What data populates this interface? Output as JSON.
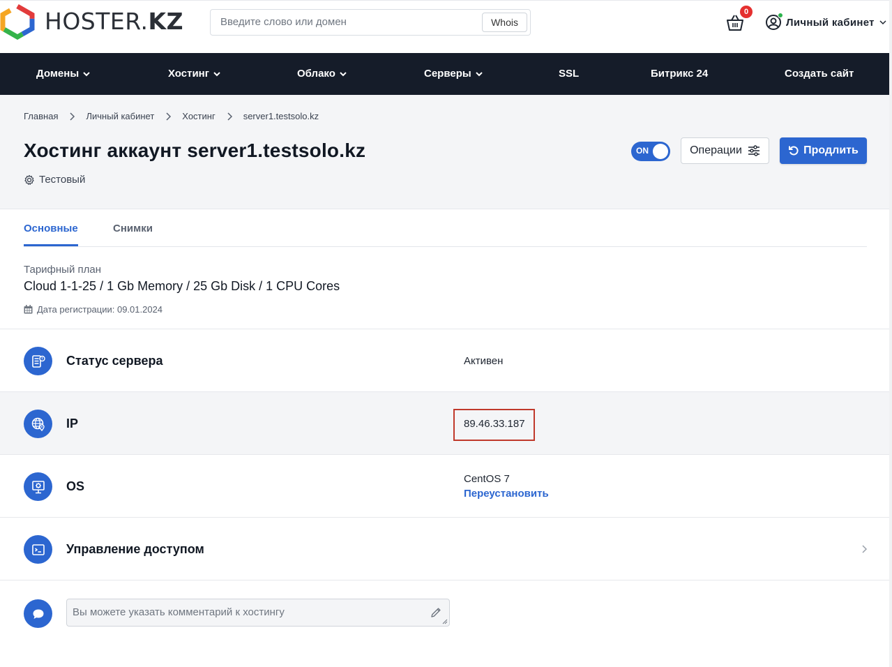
{
  "header": {
    "logo_text_light": "HOSTER.",
    "logo_text_bold": "KZ",
    "search_placeholder": "Введите слово или домен",
    "whois_label": "Whois",
    "cart_count": "0",
    "account_label": "Личный кабинет"
  },
  "nav": {
    "items": [
      {
        "label": "Домены",
        "has_dropdown": true
      },
      {
        "label": "Хостинг",
        "has_dropdown": true
      },
      {
        "label": "Облако",
        "has_dropdown": true
      },
      {
        "label": "Серверы",
        "has_dropdown": true
      },
      {
        "label": "SSL",
        "has_dropdown": false
      },
      {
        "label": "Битрикс 24",
        "has_dropdown": false
      },
      {
        "label": "Создать сайт",
        "has_dropdown": false
      }
    ]
  },
  "breadcrumb": [
    "Главная",
    "Личный кабинет",
    "Хостинг",
    "server1.testsolo.kz"
  ],
  "page": {
    "title": "Хостинг аккаунт server1.testsolo.kz",
    "tag": "Тестовый",
    "toggle_label": "ON",
    "toggle_state": true,
    "operations_label": "Операции",
    "renew_label": "Продлить"
  },
  "tabs": [
    {
      "label": "Основные",
      "active": true
    },
    {
      "label": "Снимки",
      "active": false
    }
  ],
  "plan": {
    "label": "Тарифный план",
    "value": "Cloud 1-1-25 / 1 Gb Memory / 25 Gb Disk / 1 CPU Cores",
    "reg_date": "Дата регистрации: 09.01.2024"
  },
  "rows": {
    "status": {
      "label": "Статус сервера",
      "value": "Активен",
      "icon": "server-status-icon"
    },
    "ip": {
      "label": "IP",
      "value": "89.46.33.187",
      "icon": "globe-location-icon"
    },
    "os": {
      "label": "OS",
      "value": "CentOS 7",
      "action": "Переустановить",
      "icon": "monitor-gear-icon"
    },
    "access": {
      "label": "Управление доступом",
      "icon": "terminal-icon"
    }
  },
  "comment": {
    "placeholder": "Вы можете указать комментарий к хостингу"
  },
  "colors": {
    "nav_bg": "#151c29",
    "accent": "#2c66d0",
    "badge": "#e5302f",
    "highlight_box": "#c0392b",
    "muted_bg": "#f4f5f7"
  }
}
